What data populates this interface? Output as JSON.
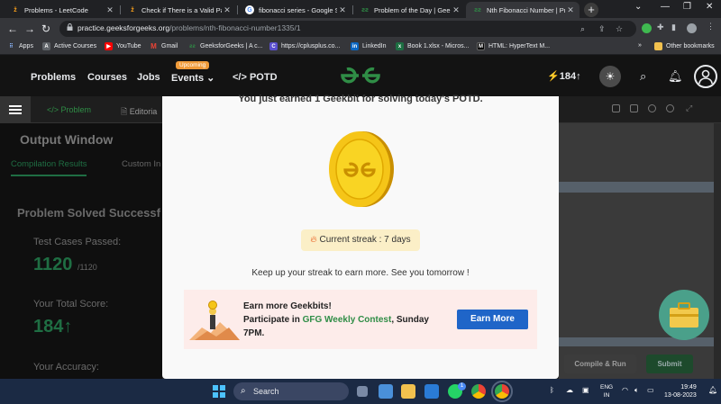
{
  "browser": {
    "tabs": [
      {
        "title": "Problems - LeetCode",
        "icon": "leetcode-icon"
      },
      {
        "title": "Check if There is a Valid Partit",
        "icon": "leetcode-icon"
      },
      {
        "title": "fibonacci series - Google Sea",
        "icon": "google-icon"
      },
      {
        "title": "Problem of the Day | Geeksfo",
        "icon": "gfg-icon"
      },
      {
        "title": "Nth Fibonacci Number | Prac",
        "icon": "gfg-icon",
        "active": true
      }
    ],
    "new_tab": "+",
    "url_host": "practice.geeksforgeeks.org",
    "url_path": "/problems/nth-fibonacci-number1335/1",
    "bookmarks": [
      {
        "label": "Apps",
        "icon": "apps-grid-icon"
      },
      {
        "label": "Active Courses",
        "icon": "course-icon"
      },
      {
        "label": "YouTube",
        "icon": "youtube-icon"
      },
      {
        "label": "Gmail",
        "icon": "gmail-icon"
      },
      {
        "label": "GeeksforGeeks | A c...",
        "icon": "gfg-icon"
      },
      {
        "label": "https://cplusplus.co...",
        "icon": "cplusplus-icon"
      },
      {
        "label": "LinkedIn",
        "icon": "linkedin-icon"
      },
      {
        "label": "Book 1.xlsx - Micros...",
        "icon": "excel-icon"
      },
      {
        "label": "HTML: HyperText M...",
        "icon": "mdn-icon"
      }
    ],
    "other_bookmarks": "Other bookmarks",
    "more_bookmarks": "»"
  },
  "header": {
    "nav": [
      "Problems",
      "Courses",
      "Jobs",
      "Events"
    ],
    "upcoming_badge": "Upcoming",
    "potd": "POTD",
    "geekbits": "184"
  },
  "subbar": {
    "problem_tab": "Problem",
    "editorial_tab": "Editoria"
  },
  "left_panel": {
    "title": "Output Window",
    "tabs": [
      "Compilation Results",
      "Custom In"
    ],
    "solved": "Problem Solved Successf",
    "tests_label": "Test Cases Passed:",
    "tests_value": "1120",
    "tests_total": "/1120",
    "score_label": "Your Total Score:",
    "score_value": "184",
    "accuracy_label": "Your Accuracy:"
  },
  "right_panel": {
    "compile_run": "Compile & Run",
    "submit": "Submit"
  },
  "modal": {
    "title": "You just earned 1 Geekbit for solving today's POTD.",
    "streak": "Current streak : 7 days",
    "keep_up": "Keep up your streak to earn more. See you tomorrow !",
    "banner_heading": "Earn more Geekbits!",
    "banner_line2_prefix": "Participate in ",
    "banner_contest": "GFG Weekly Contest",
    "banner_line2_suffix": ", Sunday",
    "banner_line3": "7PM.",
    "earn_more_button": "Earn More"
  },
  "taskbar": {
    "search": "Search",
    "lang_line1": "ENG",
    "lang_line2": "IN",
    "time": "19:49",
    "date": "13-08-2023",
    "notification_badge": "1"
  },
  "colors": {
    "gfg_green": "#2f8d46",
    "earn_more_blue": "#1f65c8",
    "coin_gold": "#f5c518",
    "banner_bg": "#fdecea",
    "streak_bg": "#fbefc7"
  }
}
